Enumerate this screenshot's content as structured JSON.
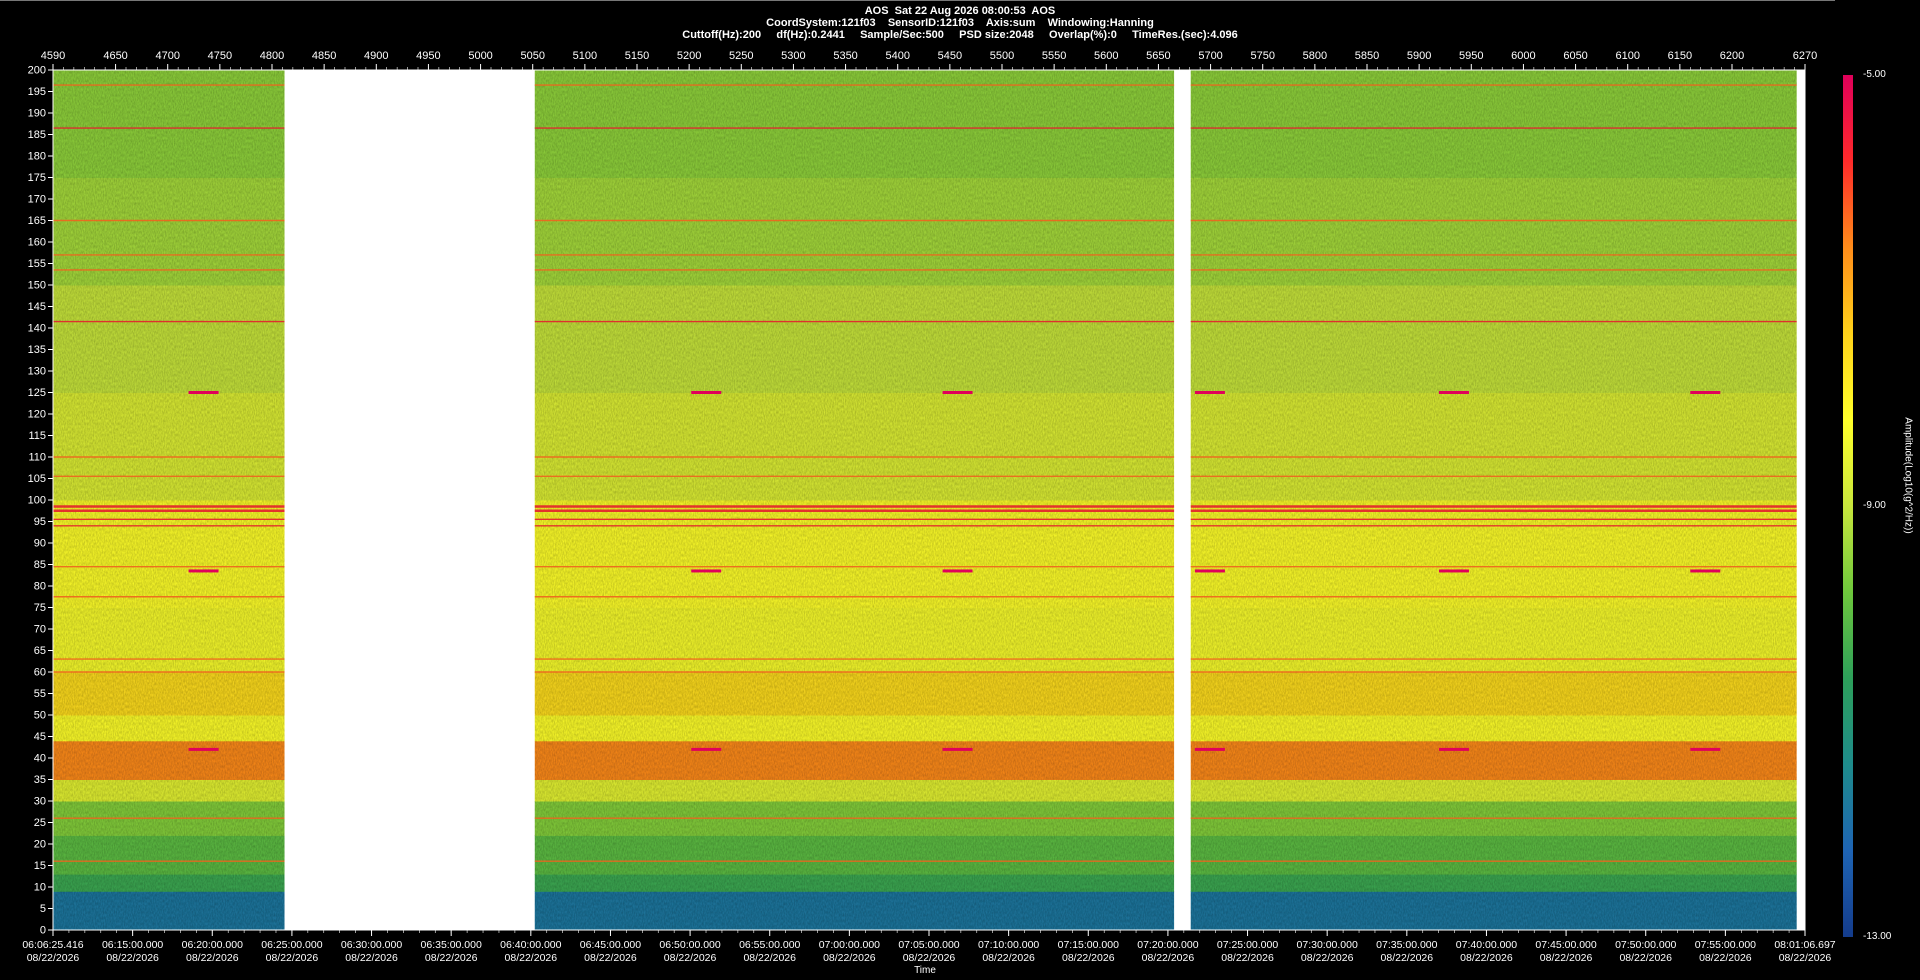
{
  "header": {
    "line1": "AOS  Sat 22 Aug 2026 08:00:53  AOS",
    "line2": "CoordSystem:121f03    SensorID:121f03    Axis:sum    Windowing:Hanning",
    "line3": "Cuttoff(Hz):200     df(Hz):0.2441     Sample/Sec:500     PSD size:2048     Overlap(%):0     TimeRes.(sec):4.096"
  },
  "colorbar": {
    "label": "Amplitude(Log10(g^2/Hz))",
    "ticks": [
      "-5.00",
      "-9.00",
      "-13.00"
    ],
    "colors": [
      "#e0005a",
      "#ff2a2a",
      "#ff8c1a",
      "#ffd21a",
      "#ffff2a",
      "#c8e63c",
      "#6ec83c",
      "#2da05a",
      "#1e8c8c",
      "#1e64b4",
      "#143c8c"
    ]
  },
  "chart_data": {
    "type": "heatmap",
    "title": "AOS  Sat 22 Aug 2026 08:00:53  AOS",
    "xlabel": "Time",
    "ylabel": "",
    "ylim": [
      0,
      200
    ],
    "top_axis": {
      "ticks": [
        "4590",
        "4650",
        "4700",
        "4750",
        "4800",
        "4850",
        "4900",
        "4950",
        "5000",
        "5050",
        "5100",
        "5150",
        "5200",
        "5250",
        "5300",
        "5350",
        "5400",
        "5450",
        "5500",
        "5550",
        "5600",
        "5650",
        "5700",
        "5750",
        "5800",
        "5850",
        "5900",
        "5950",
        "6000",
        "6050",
        "6100",
        "6150",
        "6200",
        "6270"
      ],
      "values": [
        4590,
        4650,
        4700,
        4750,
        4800,
        4850,
        4900,
        4950,
        5000,
        5050,
        5100,
        5150,
        5200,
        5250,
        5300,
        5350,
        5400,
        5450,
        5500,
        5550,
        5600,
        5650,
        5700,
        5750,
        5800,
        5850,
        5900,
        5950,
        6000,
        6050,
        6100,
        6150,
        6200,
        6270
      ]
    },
    "xlim": [
      4590,
      6270
    ],
    "y_ticks": [
      0,
      5,
      10,
      15,
      20,
      25,
      30,
      35,
      40,
      45,
      50,
      55,
      60,
      65,
      70,
      75,
      80,
      85,
      90,
      95,
      100,
      105,
      110,
      115,
      120,
      125,
      130,
      135,
      140,
      145,
      150,
      155,
      160,
      165,
      170,
      175,
      180,
      185,
      190,
      195,
      200
    ],
    "time_ticks": [
      {
        "t": "06:06:25.416",
        "d": "08/22/2026"
      },
      {
        "t": "06:15:00.000",
        "d": "08/22/2026"
      },
      {
        "t": "06:20:00.000",
        "d": "08/22/2026"
      },
      {
        "t": "06:25:00.000",
        "d": "08/22/2026"
      },
      {
        "t": "06:30:00.000",
        "d": "08/22/2026"
      },
      {
        "t": "06:35:00.000",
        "d": "08/22/2026"
      },
      {
        "t": "06:40:00.000",
        "d": "08/22/2026"
      },
      {
        "t": "06:45:00.000",
        "d": "08/22/2026"
      },
      {
        "t": "06:50:00.000",
        "d": "08/22/2026"
      },
      {
        "t": "06:55:00.000",
        "d": "08/22/2026"
      },
      {
        "t": "07:00:00.000",
        "d": "08/22/2026"
      },
      {
        "t": "07:05:00.000",
        "d": "08/22/2026"
      },
      {
        "t": "07:10:00.000",
        "d": "08/22/2026"
      },
      {
        "t": "07:15:00.000",
        "d": "08/22/2026"
      },
      {
        "t": "07:20:00.000",
        "d": "08/22/2026"
      },
      {
        "t": "07:25:00.000",
        "d": "08/22/2026"
      },
      {
        "t": "07:30:00.000",
        "d": "08/22/2026"
      },
      {
        "t": "07:35:00.000",
        "d": "08/22/2026"
      },
      {
        "t": "07:40:00.000",
        "d": "08/22/2026"
      },
      {
        "t": "07:45:00.000",
        "d": "08/22/2026"
      },
      {
        "t": "07:50:00.000",
        "d": "08/22/2026"
      },
      {
        "t": "07:55:00.000",
        "d": "08/22/2026"
      },
      {
        "t": "08:01:06.697",
        "d": "08/22/2026"
      }
    ],
    "data_segments": [
      [
        4590,
        4812
      ],
      [
        5052,
        5665
      ],
      [
        5681,
        6262
      ]
    ],
    "color_scale": {
      "min": -13.0,
      "max": -5.0
    },
    "bands": [
      {
        "from": 0,
        "to": 9,
        "level": -11.8
      },
      {
        "from": 9,
        "to": 13,
        "level": -10.4
      },
      {
        "from": 13,
        "to": 22,
        "level": -10.0
      },
      {
        "from": 22,
        "to": 30,
        "level": -9.6
      },
      {
        "from": 30,
        "to": 35,
        "level": -8.6
      },
      {
        "from": 35,
        "to": 44,
        "level": -6.6
      },
      {
        "from": 44,
        "to": 50,
        "level": -8.2
      },
      {
        "from": 50,
        "to": 60,
        "level": -7.6
      },
      {
        "from": 60,
        "to": 75,
        "level": -8.3
      },
      {
        "from": 75,
        "to": 100,
        "level": -8.2
      },
      {
        "from": 100,
        "to": 125,
        "level": -8.7
      },
      {
        "from": 125,
        "to": 150,
        "level": -9.0
      },
      {
        "from": 150,
        "to": 175,
        "level": -9.3
      },
      {
        "from": 175,
        "to": 200,
        "level": -9.5
      }
    ],
    "tones": [
      196.5,
      186.5,
      165,
      157,
      153.5,
      141.5,
      110,
      105.5,
      98.5,
      97.5,
      95.5,
      94,
      84.5,
      77.5,
      63,
      60,
      26,
      16
    ],
    "events_x": [
      4720,
      5202,
      5443,
      5685,
      5919,
      6160
    ]
  }
}
